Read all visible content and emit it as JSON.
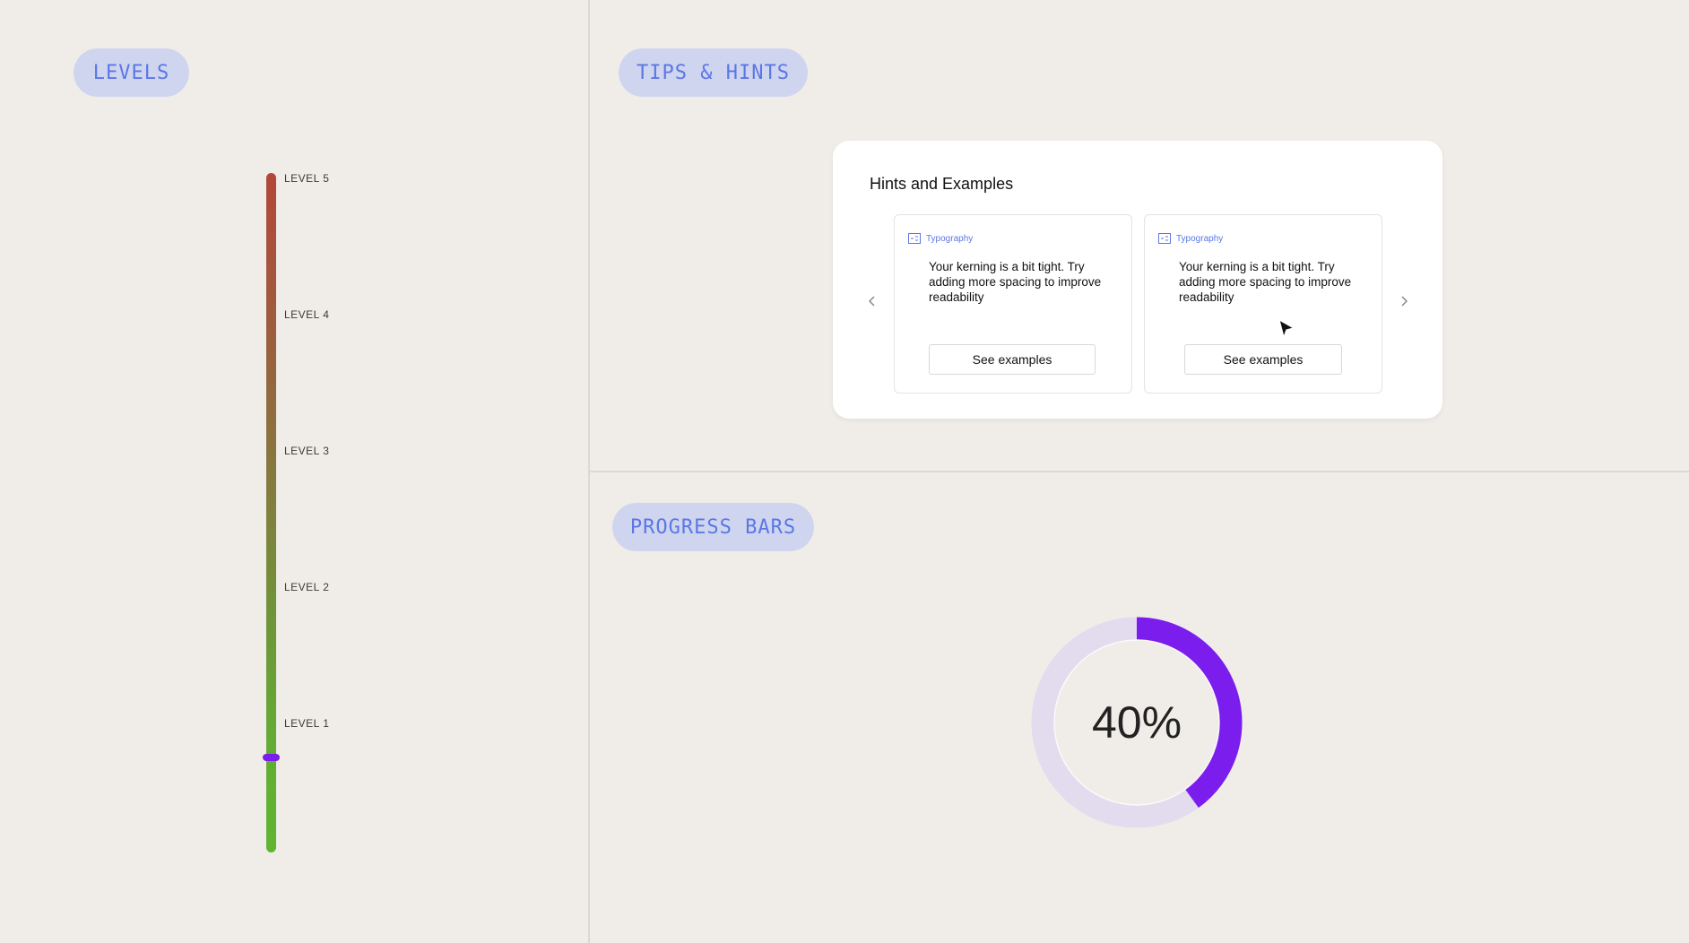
{
  "sections": {
    "levels": "LEVELS",
    "tips": "TIPS & HINTS",
    "progress": "PROGRESS BARS"
  },
  "levels": {
    "labels": [
      "LEVEL 5",
      "LEVEL 4",
      "LEVEL 3",
      "LEVEL 2",
      "LEVEL 1"
    ],
    "current_value_fraction": 0.14,
    "gradient_colors": [
      "#b3473a",
      "#847a3f",
      "#5fb531"
    ],
    "marker_color": "#7b1ded"
  },
  "hints": {
    "title": "Hints and Examples",
    "items": [
      {
        "tag": "Typography",
        "text": "Your kerning is a bit tight. Try adding more spacing to improve readability",
        "button": "See examples"
      },
      {
        "tag": "Typography",
        "text": "Your kerning is a bit tight. Try adding more spacing to improve readability",
        "button": "See examples"
      }
    ],
    "prev_icon": "chevron-left-icon",
    "next_icon": "chevron-right-icon"
  },
  "progress": {
    "value_percent": 40,
    "label": "40%",
    "fill_color": "#7b1ded",
    "track_color": "#e2dcee"
  }
}
